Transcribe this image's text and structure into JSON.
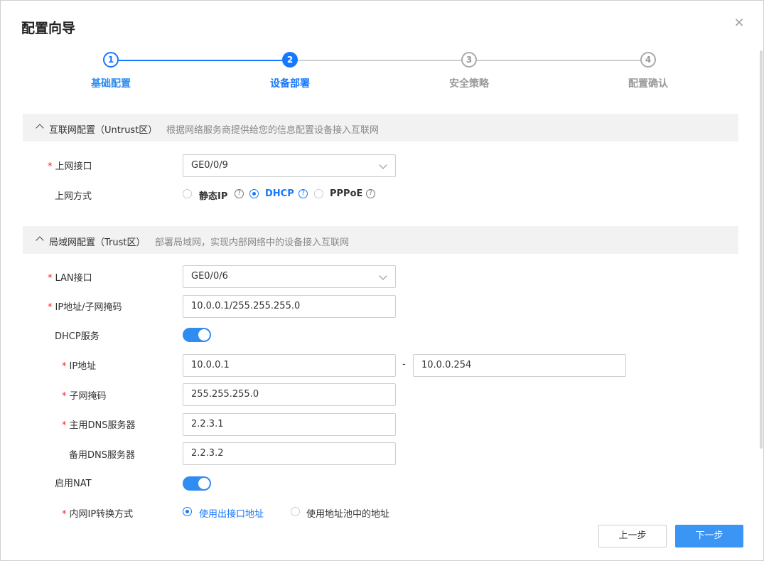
{
  "dialog": {
    "title": "配置向导",
    "close_glyph": "×"
  },
  "steps": [
    {
      "num": "1",
      "label": "基础配置",
      "state": "done"
    },
    {
      "num": "2",
      "label": "设备部署",
      "state": "active"
    },
    {
      "num": "3",
      "label": "安全策略",
      "state": "todo"
    },
    {
      "num": "4",
      "label": "配置确认",
      "state": "todo"
    }
  ],
  "internet": {
    "title": "互联网配置（Untrust区）",
    "desc": "根据网络服务商提供给您的信息配置设备接入互联网",
    "uplink_label": "上网接口",
    "uplink_value": "GE0/0/9",
    "mode_label": "上网方式",
    "modes": [
      {
        "label": "静态IP",
        "selected": false
      },
      {
        "label": "DHCP",
        "selected": true
      },
      {
        "label": "PPPoE",
        "selected": false
      }
    ]
  },
  "lan": {
    "title": "局域网配置（Trust区）",
    "desc": "部署局域网，实现内部网络中的设备接入互联网",
    "lan_port_label": "LAN接口",
    "lan_port_value": "GE0/0/6",
    "ip_mask_label": "IP地址/子网掩码",
    "ip_mask_value": "10.0.0.1/255.255.255.0",
    "dhcp_label": "DHCP服务",
    "dhcp_enabled": true,
    "ip_range_label": "IP地址",
    "ip_start": "10.0.0.1",
    "range_sep": "-",
    "ip_end": "10.0.0.254",
    "mask_label": "子网掩码",
    "mask_value": "255.255.255.0",
    "dns1_label": "主用DNS服务器",
    "dns1_value": "2.2.3.1",
    "dns2_label": "备用DNS服务器",
    "dns2_value": "2.2.3.2",
    "nat_label": "启用NAT",
    "nat_enabled": true,
    "nat_mode_label": "内网IP转换方式",
    "nat_modes": [
      {
        "label": "使用出接口地址",
        "selected": true
      },
      {
        "label": "使用地址池中的地址",
        "selected": false
      }
    ]
  },
  "footer": {
    "prev_label": "上一步",
    "next_label": "下一步"
  },
  "colors": {
    "primary": "#1677ff",
    "required": "#f5222d"
  },
  "help_glyph": "?"
}
